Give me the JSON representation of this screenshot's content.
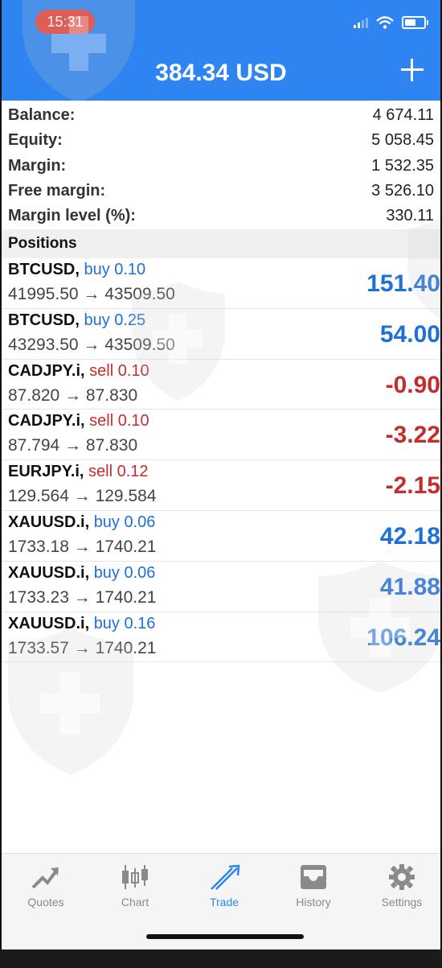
{
  "status": {
    "time": "15:31"
  },
  "header": {
    "title": "384.34 USD"
  },
  "summary": [
    {
      "label": "Balance:",
      "value": "4 674.11"
    },
    {
      "label": "Equity:",
      "value": "5 058.45"
    },
    {
      "label": "Margin:",
      "value": "1 532.35"
    },
    {
      "label": "Free margin:",
      "value": "3 526.10"
    },
    {
      "label": "Margin level (%):",
      "value": "330.11"
    }
  ],
  "positions_title": "Positions",
  "positions": [
    {
      "symbol": "BTCUSD,",
      "direction": "buy 0.10",
      "type": "buy",
      "prices": "41995.50 → 43509.50",
      "profit": "151.40"
    },
    {
      "symbol": "BTCUSD,",
      "direction": "buy 0.25",
      "type": "buy",
      "prices": "43293.50 → 43509.50",
      "profit": "54.00"
    },
    {
      "symbol": "CADJPY.i,",
      "direction": "sell 0.10",
      "type": "sell",
      "prices": "87.820 → 87.830",
      "profit": "-0.90"
    },
    {
      "symbol": "CADJPY.i,",
      "direction": "sell 0.10",
      "type": "sell",
      "prices": "87.794 → 87.830",
      "profit": "-3.22"
    },
    {
      "symbol": "EURJPY.i,",
      "direction": "sell 0.12",
      "type": "sell",
      "prices": "129.564 → 129.584",
      "profit": "-2.15"
    },
    {
      "symbol": "XAUUSD.i,",
      "direction": "buy 0.06",
      "type": "buy",
      "prices": "1733.18 → 1740.21",
      "profit": "42.18"
    },
    {
      "symbol": "XAUUSD.i,",
      "direction": "buy 0.06",
      "type": "buy",
      "prices": "1733.23 → 1740.21",
      "profit": "41.88"
    },
    {
      "symbol": "XAUUSD.i,",
      "direction": "buy 0.16",
      "type": "buy",
      "prices": "1733.57 → 1740.21",
      "profit": "106.24"
    }
  ],
  "tabs": [
    {
      "label": "Quotes",
      "icon": "quotes-icon",
      "active": false
    },
    {
      "label": "Chart",
      "icon": "chart-icon",
      "active": false
    },
    {
      "label": "Trade",
      "icon": "trade-icon",
      "active": true
    },
    {
      "label": "History",
      "icon": "history-icon",
      "active": false
    },
    {
      "label": "Settings",
      "icon": "settings-icon",
      "active": false
    }
  ],
  "colors": {
    "accent": "#2e84f0",
    "buy": "#1e6fd9",
    "sell": "#c62c2c"
  }
}
